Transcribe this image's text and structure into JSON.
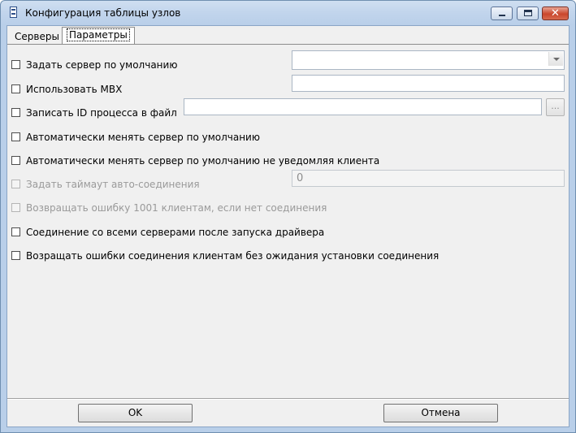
{
  "window": {
    "title": "Конфигурация таблицы узлов",
    "minimize_icon": "minimize-icon",
    "maximize_icon": "maximize-icon",
    "close_icon": "close-icon",
    "close_glyph": "✕"
  },
  "tabs": [
    {
      "label": "Серверы",
      "selected": false
    },
    {
      "label": "Параметры",
      "selected": true
    }
  ],
  "options": {
    "default_server": {
      "label": "Задать сервер по умолчанию",
      "checked": false,
      "value": ""
    },
    "use_mbx": {
      "label": "Использовать MBX",
      "checked": false,
      "value": ""
    },
    "write_pid": {
      "label": "Записать ID процесса в файл",
      "checked": false,
      "value": "",
      "browse_label": "..."
    },
    "auto_switch_default": {
      "label": "Автоматически менять сервер по умолчанию",
      "checked": false
    },
    "auto_switch_silent": {
      "label": "Автоматически менять сервер по умолчанию не уведомляя клиента",
      "checked": false
    },
    "auto_connect_timeout": {
      "label": "Задать таймаут авто-соединения",
      "checked": false,
      "disabled": true,
      "value": "0"
    },
    "return_error_1001": {
      "label": "Возвращать ошибку 1001 клиентам, если нет соединения",
      "checked": false,
      "disabled": true
    },
    "connect_all_servers": {
      "label": "Соединение со всеми серверами после запуска драйвера",
      "checked": false
    },
    "return_errors_no_wait": {
      "label": "Возращать ошибки соединения клиентам без ожидания установки соединения",
      "checked": false
    }
  },
  "buttons": {
    "ok": "OK",
    "cancel": "Отмена"
  },
  "colors": {
    "titlebar": "#c2d5ec",
    "dialog_bg": "#f0f0f0",
    "close_button": "#c9462d"
  }
}
